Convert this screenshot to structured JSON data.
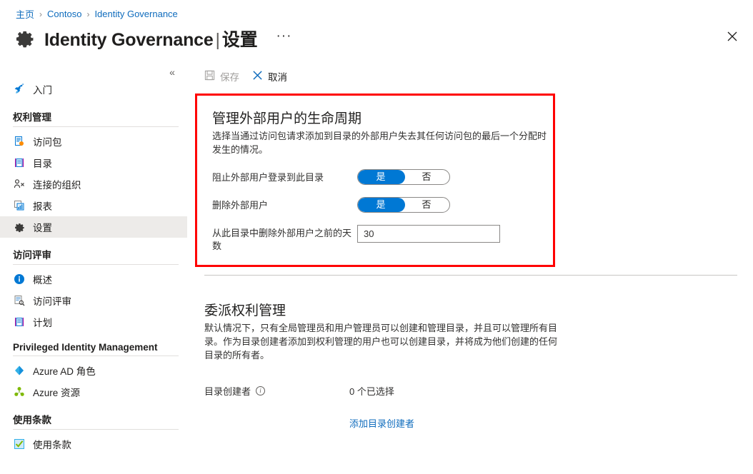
{
  "breadcrumb": {
    "items": [
      {
        "label": "主页",
        "kind": "link"
      },
      {
        "label": "Contoso",
        "kind": "link"
      },
      {
        "label": "Identity Governance",
        "kind": "link"
      }
    ],
    "separator": "›"
  },
  "header": {
    "title": "Identity Governance",
    "separator": "|",
    "subtitle": "设置",
    "ellipsis": "···",
    "icon": "gear-icon",
    "close_icon": "close-icon"
  },
  "sidebar": {
    "collapse_icon": "«",
    "items": [
      {
        "label": "入门",
        "icon": "rocket-icon",
        "type": "item",
        "selected": false
      },
      {
        "label": "权利管理",
        "type": "group"
      },
      {
        "label": "访问包",
        "icon": "access-package-icon",
        "type": "item",
        "selected": false
      },
      {
        "label": "目录",
        "icon": "catalog-icon",
        "type": "item",
        "selected": false
      },
      {
        "label": "连接的组织",
        "icon": "connected-org-icon",
        "type": "item",
        "selected": false
      },
      {
        "label": "报表",
        "icon": "report-icon",
        "type": "item",
        "selected": false
      },
      {
        "label": "设置",
        "icon": "gear-icon",
        "type": "item",
        "selected": true
      },
      {
        "label": "访问评审",
        "type": "group"
      },
      {
        "label": "概述",
        "icon": "info-circle-icon",
        "type": "item",
        "selected": false
      },
      {
        "label": "访问评审",
        "icon": "review-search-icon",
        "type": "item",
        "selected": false
      },
      {
        "label": "计划",
        "icon": "plan-icon",
        "type": "item",
        "selected": false
      },
      {
        "label": "Privileged Identity Management",
        "type": "group"
      },
      {
        "label": "Azure AD 角色",
        "icon": "azure-ad-roles-icon",
        "type": "item",
        "selected": false
      },
      {
        "label": "Azure 资源",
        "icon": "azure-resources-icon",
        "type": "item",
        "selected": false
      },
      {
        "label": "使用条款",
        "type": "group"
      },
      {
        "label": "使用条款",
        "icon": "terms-of-use-icon",
        "type": "item",
        "selected": false
      }
    ]
  },
  "toolbar": {
    "save_label": "保存",
    "save_icon": "save-disk-icon",
    "save_disabled": true,
    "cancel_label": "取消",
    "cancel_icon": "cancel-x-icon"
  },
  "lifecycle_section": {
    "title": "管理外部用户的生命周期",
    "description": "选择当通过访问包请求添加到目录的外部用户失去其任何访问包的最后一个分配时发生的情况。",
    "highlight_color": "#ff0000",
    "fields": [
      {
        "label": "阻止外部用户登录到此目录",
        "type": "toggle",
        "options": [
          "是",
          "否"
        ],
        "value": "是"
      },
      {
        "label": "删除外部用户",
        "type": "toggle",
        "options": [
          "是",
          "否"
        ],
        "value": "是"
      },
      {
        "label": "从此目录中删除外部用户之前的天数",
        "type": "number",
        "value": "30"
      }
    ]
  },
  "delegate_section": {
    "title": "委派权利管理",
    "description": "默认情况下，只有全局管理员和用户管理员可以创建和管理目录，并且可以管理所有目录。作为目录创建者添加到权利管理的用户也可以创建目录，并将成为他们创建的任何目录的所有者。",
    "field_label": "目录创建者",
    "info_icon": "info-icon",
    "selected_count_text": "0 个已选择",
    "add_link_text": "添加目录创建者"
  },
  "colors": {
    "accent": "#0078d4",
    "link": "#0f6cbd",
    "highlight": "#ff0000",
    "selected_bg": "#edebe9"
  }
}
